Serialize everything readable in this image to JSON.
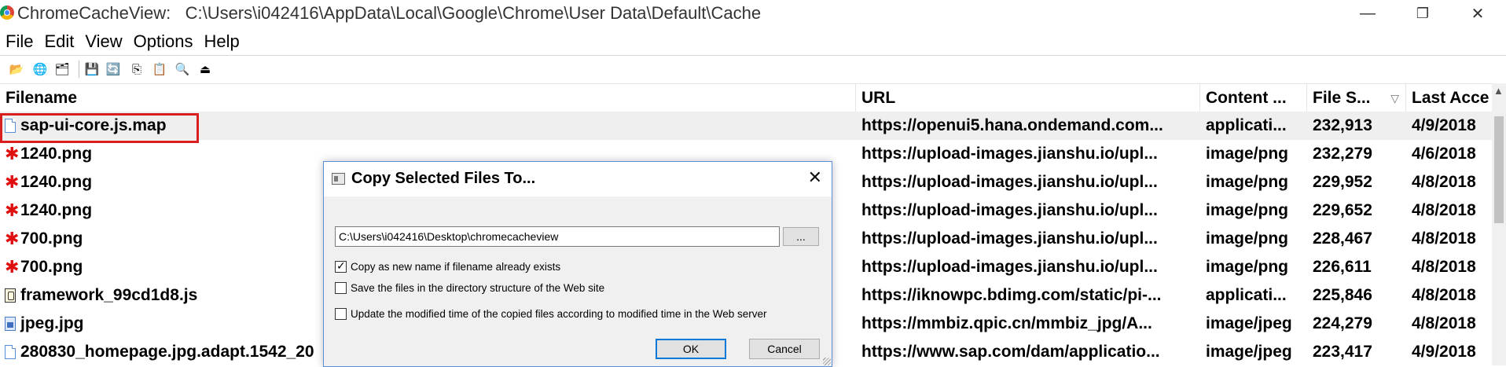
{
  "window": {
    "title": "ChromeCacheView:   C:\\Users\\i042416\\AppData\\Local\\Google\\Chrome\\User Data\\Default\\Cache",
    "controls": {
      "minimize": "—",
      "restore": "❐",
      "close": "✕"
    }
  },
  "menu": [
    "File",
    "Edit",
    "View",
    "Options",
    "Help"
  ],
  "toolbar": {
    "icons": [
      "open-folder-icon",
      "globe-icon",
      "select-folder-icon",
      "save-icon",
      "refresh-icon",
      "copy-icon",
      "properties-icon",
      "find-icon",
      "exit-icon"
    ],
    "glyphs": [
      "📂",
      "🌐",
      "🗂",
      "💾",
      "🔄",
      "⎘",
      "📋",
      "🔍",
      "⏏"
    ]
  },
  "list": {
    "columns": [
      "Filename",
      "URL",
      "Content ...",
      "File S...",
      "Last Acce"
    ],
    "sort_indicator": "▽",
    "rows": [
      {
        "icon": "doc",
        "filename": "sap-ui-core.js.map",
        "url": "https://openui5.hana.ondemand.com...",
        "content": "applicati...",
        "size": "232,913",
        "accessed": "4/9/2018",
        "selected": true
      },
      {
        "icon": "png",
        "filename": "1240.png",
        "url": "https://upload-images.jianshu.io/upl...",
        "content": "image/png",
        "size": "232,279",
        "accessed": "4/6/2018"
      },
      {
        "icon": "png",
        "filename": "1240.png",
        "url": "https://upload-images.jianshu.io/upl...",
        "content": "image/png",
        "size": "229,952",
        "accessed": "4/8/2018"
      },
      {
        "icon": "png",
        "filename": "1240.png",
        "url": "https://upload-images.jianshu.io/upl...",
        "content": "image/png",
        "size": "229,652",
        "accessed": "4/8/2018"
      },
      {
        "icon": "png",
        "filename": "700.png",
        "url": "https://upload-images.jianshu.io/upl...",
        "content": "image/png",
        "size": "228,467",
        "accessed": "4/8/2018"
      },
      {
        "icon": "png",
        "filename": "700.png",
        "url": "https://upload-images.jianshu.io/upl...",
        "content": "image/png",
        "size": "226,611",
        "accessed": "4/8/2018"
      },
      {
        "icon": "js",
        "filename": "framework_99cd1d8.js",
        "url": "https://iknowpc.bdimg.com/static/pi-...",
        "content": "applicati...",
        "size": "225,846",
        "accessed": "4/8/2018"
      },
      {
        "icon": "jpg",
        "filename": "jpeg.jpg",
        "url": "https://mmbiz.qpic.cn/mmbiz_jpg/A...",
        "content": "image/jpeg",
        "size": "224,279",
        "accessed": "4/8/2018"
      },
      {
        "icon": "doc",
        "filename": "280830_homepage.jpg.adapt.1542_20",
        "url": "https://www.sap.com/dam/applicatio...",
        "content": "image/jpeg",
        "size": "223,417",
        "accessed": "4/9/2018"
      }
    ]
  },
  "dialog": {
    "title": "Copy Selected Files To...",
    "close_glyph": "✕",
    "path_value": "C:\\Users\\i042416\\Desktop\\chromecacheview",
    "browse_label": "...",
    "options": [
      {
        "label": "Copy as new name if filename already exists",
        "checked": true
      },
      {
        "label": "Save the files in the directory structure of the Web site",
        "checked": false
      },
      {
        "label": "Update the modified time of the copied files according to modified time in the Web server",
        "checked": false
      }
    ],
    "ok_label": "OK",
    "cancel_label": "Cancel"
  }
}
